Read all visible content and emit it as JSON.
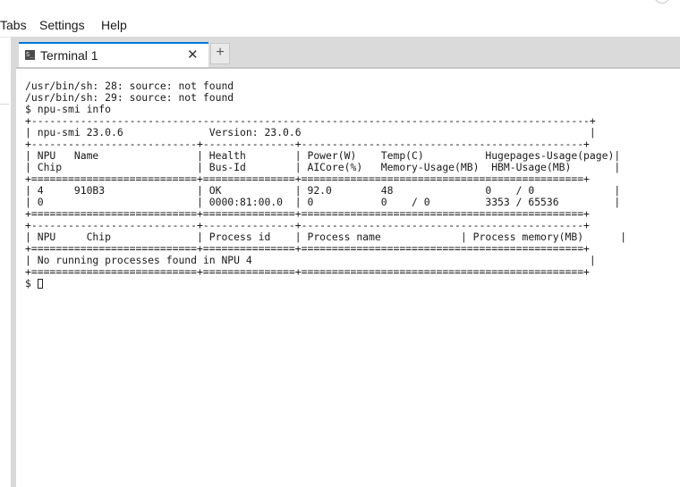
{
  "menu": {
    "items": [
      "Tabs",
      "Settings",
      "Help"
    ]
  },
  "tabs": [
    {
      "label": "Terminal 1",
      "close": "✕"
    }
  ],
  "new_tab_label": "+",
  "terminal": {
    "lines": [
      "/usr/bin/sh: 28: source: not found",
      "/usr/bin/sh: 29: source: not found",
      "$ npu-smi info",
      "+-------------------------------------------------------------------------------------------+",
      "| npu-smi 23.0.6              Version: 23.0.6                                               |",
      "+---------------------------+---------------+----------------------------------------------+",
      "| NPU   Name                | Health        | Power(W)    Temp(C)          Hugepages-Usage(page)|",
      "| Chip                      | Bus-Id        | AICore(%)   Memory-Usage(MB)  HBM-Usage(MB)       |",
      "+===========================+===============+==============================================+",
      "| 4     910B3               | OK            | 92.0        48               0    / 0             |",
      "| 0                         | 0000:81:00.0  | 0           0    / 0         3353 / 65536         |",
      "+===========================+===============+==============================================+",
      "+---------------------------+---------------+----------------------------------------------+",
      "| NPU     Chip              | Process id    | Process name             | Process memory(MB)      |",
      "+===========================+===============+==============================================+",
      "| No running processes found in NPU 4                                                       |",
      "+===========================+===============+==============================================+"
    ],
    "prompt": "$ "
  }
}
